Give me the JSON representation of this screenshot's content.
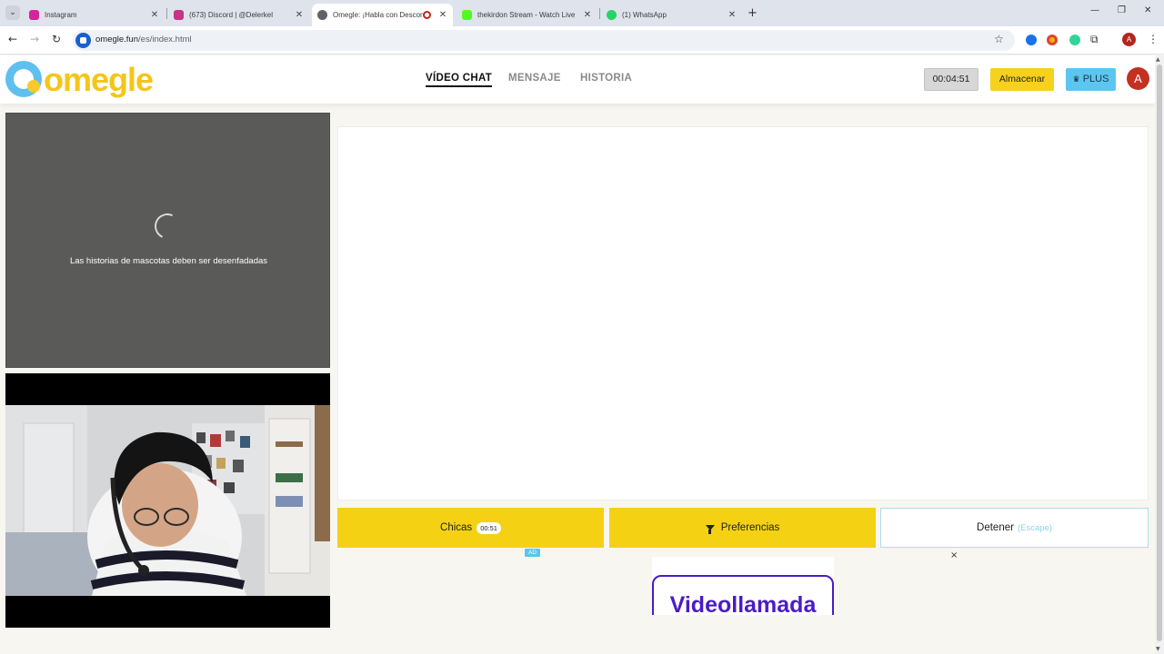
{
  "browser": {
    "tabs": [
      {
        "title": "Instagram",
        "favicon_color": "#d6249f",
        "active": false
      },
      {
        "title": "(673) Discord | @Delerkel",
        "favicon_color": "#c13584",
        "active": false
      },
      {
        "title": "Omegle: ¡Habla con Descon",
        "favicon_color": "#5f6368",
        "active": true
      },
      {
        "title": "thekirdon Stream - Watch Live",
        "favicon_color": "#53fc18",
        "active": false
      },
      {
        "title": "(1) WhatsApp",
        "favicon_color": "#25d366",
        "active": false
      }
    ],
    "url_host": "omegle.fun",
    "url_path": "/es/index.html",
    "profile_initial": "A"
  },
  "header": {
    "logo_text": "omegle",
    "nav": [
      {
        "label": "VÍDEO CHAT",
        "active": true
      },
      {
        "label": "MENSAJE",
        "active": false
      },
      {
        "label": "HISTORIA",
        "active": false
      }
    ],
    "timer": "00:04:51",
    "store_label": "Almacenar",
    "plus_label": "PLUS",
    "avatar_initial": "A"
  },
  "stranger": {
    "message": "Las historias de mascotas deben ser desenfadadas"
  },
  "actions": {
    "chicas_label": "Chicas",
    "chicas_timer": "00:51",
    "prefs_label": "Preferencias",
    "stop_label": "Detener",
    "stop_hint": "(Escape)"
  },
  "ad": {
    "badge": "AD",
    "close": "×",
    "text": "Videollamada"
  },
  "colors": {
    "accent_yellow": "#f5d114",
    "plus_blue": "#5bc6f0",
    "ad_purple": "#4b1cc4"
  }
}
